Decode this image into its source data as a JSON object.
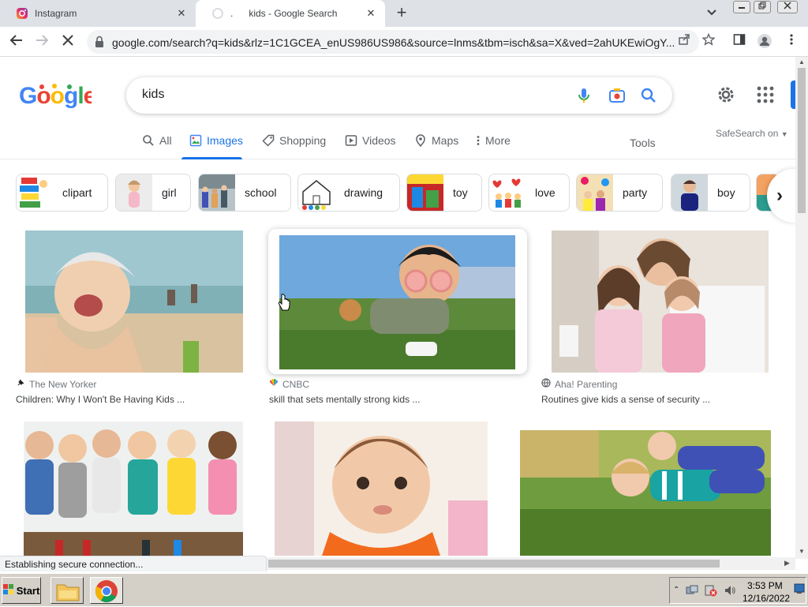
{
  "browser": {
    "tabs": [
      {
        "title": "Instagram",
        "favicon": "instagram-icon"
      },
      {
        "title": "kids - Google Search",
        "prefix": ".",
        "favicon": "loading-icon"
      }
    ],
    "url": "google.com/search?q=kids&rlz=1C1GCEA_enUS986US986&source=lnms&tbm=isch&sa=X&ved=2ahUKEwiOgY...",
    "status": "Establishing secure connection..."
  },
  "google": {
    "logo_text": "Google",
    "query": "kids",
    "nav": [
      {
        "label": "All",
        "icon": "search-icon"
      },
      {
        "label": "Images",
        "icon": "image-icon"
      },
      {
        "label": "Shopping",
        "icon": "tag-icon"
      },
      {
        "label": "Videos",
        "icon": "play-icon"
      },
      {
        "label": "Maps",
        "icon": "pin-icon"
      },
      {
        "label": "More",
        "icon": "more-icon"
      }
    ],
    "tools_label": "Tools",
    "safesearch": "SafeSearch on",
    "chips": [
      "clipart",
      "girl",
      "school",
      "drawing",
      "toy",
      "love",
      "party",
      "boy"
    ],
    "results": [
      {
        "source": "The New Yorker",
        "title": "Children: Why I Won't Be Having Kids ..."
      },
      {
        "source": "CNBC",
        "title": "skill that sets mentally strong kids ..."
      },
      {
        "source": "Aha! Parenting",
        "title": "Routines give kids a sense of security ..."
      }
    ]
  },
  "taskbar": {
    "start": "Start",
    "time": "3:53 PM",
    "date": "12/16/2022"
  },
  "colors": {
    "accent": "#1a73e8",
    "tab_bg": "#dee1e6"
  }
}
